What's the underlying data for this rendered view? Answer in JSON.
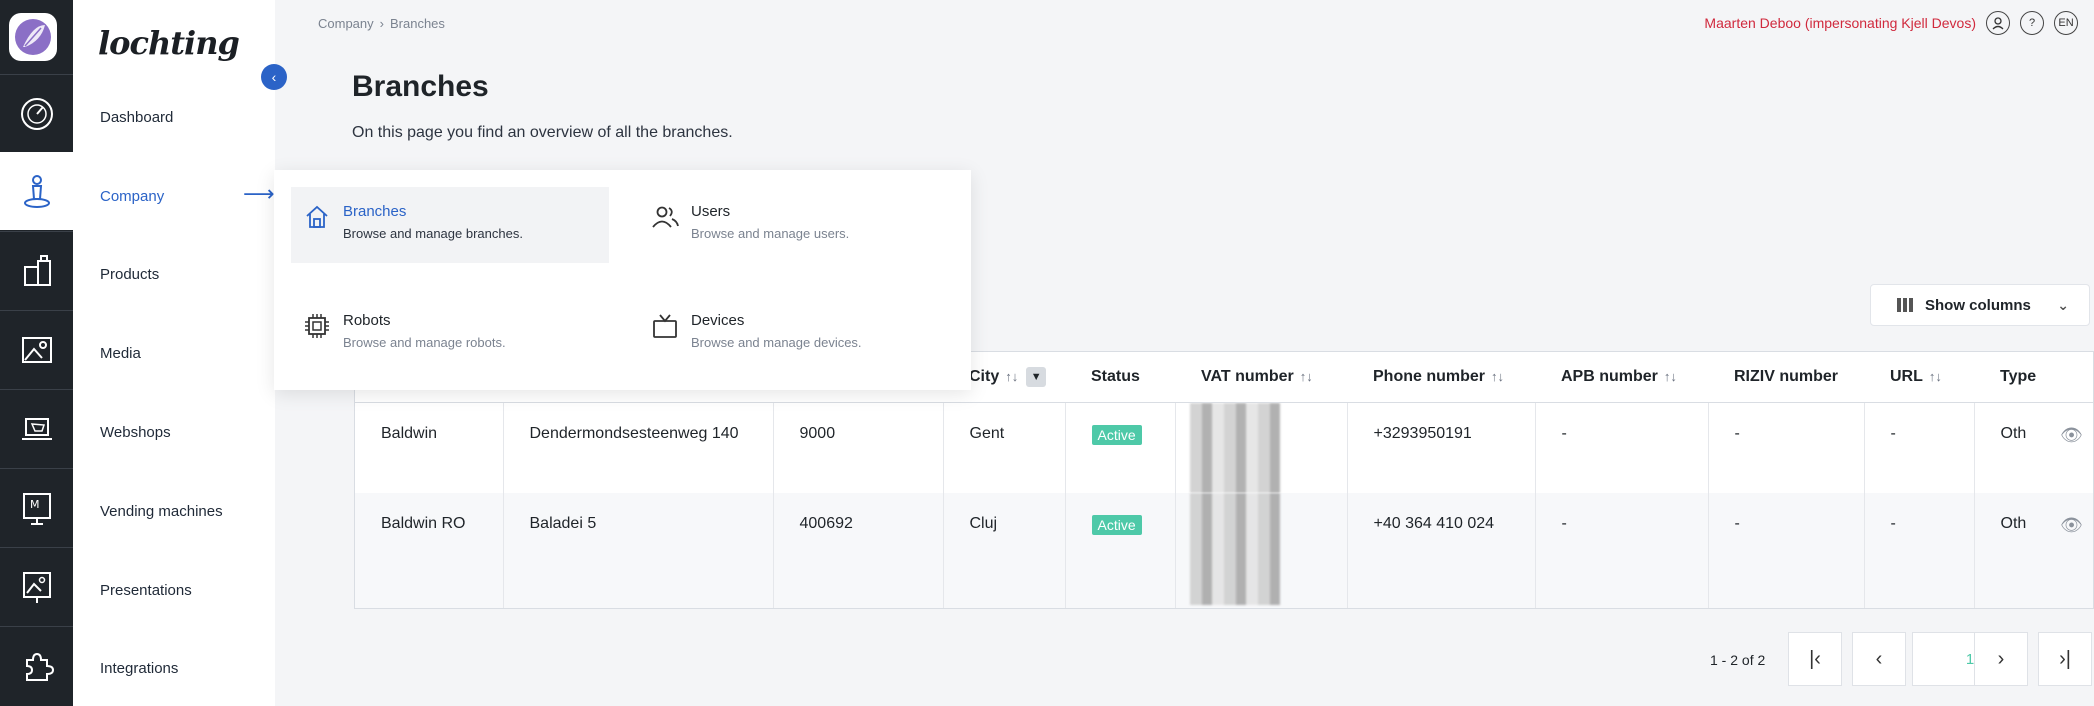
{
  "app": {
    "brand": "lochting"
  },
  "menu": {
    "items": [
      {
        "label": "Dashboard",
        "icon": "dashboard-gauge-icon"
      },
      {
        "label": "Company",
        "icon": "company-person-icon",
        "active": true
      },
      {
        "label": "Products",
        "icon": "products-icon"
      },
      {
        "label": "Media",
        "icon": "media-image-icon"
      },
      {
        "label": "Webshops",
        "icon": "webshop-laptop-icon"
      },
      {
        "label": "Vending machines",
        "icon": "vending-machine-icon"
      },
      {
        "label": "Presentations",
        "icon": "presentation-icon"
      },
      {
        "label": "Integrations",
        "icon": "puzzle-icon"
      }
    ]
  },
  "breadcrumb": {
    "parent": "Company",
    "current": "Branches"
  },
  "user": {
    "name": "Maarten Deboo (impersonating Kjell Devos)",
    "language": "EN",
    "help": "?"
  },
  "page": {
    "title": "Branches",
    "description": "On this page you find an overview of all the branches."
  },
  "dropdown": {
    "items": [
      {
        "title": "Branches",
        "subtitle": "Browse and manage branches.",
        "icon": "home-icon"
      },
      {
        "title": "Users",
        "subtitle": "Browse and manage users.",
        "icon": "users-icon"
      },
      {
        "title": "Robots",
        "subtitle": "Browse and manage robots.",
        "icon": "chip-icon"
      },
      {
        "title": "Devices",
        "subtitle": "Browse and manage devices.",
        "icon": "tv-icon"
      }
    ]
  },
  "toolbar": {
    "show_columns": "Show columns"
  },
  "table": {
    "headers": {
      "city": "City",
      "status": "Status",
      "vat": "VAT number",
      "phone": "Phone number",
      "apb": "APB number",
      "riziv": "RIZIV number",
      "url": "URL",
      "type": "Type"
    },
    "rows": [
      {
        "name": "Baldwin",
        "address": "Dendermondsesteenweg 140",
        "postal": "9000",
        "city": "Gent",
        "status": "Active",
        "phone": "+3293950191",
        "apb": "-",
        "riziv": "-",
        "url": "-",
        "type": "Oth"
      },
      {
        "name": "Baldwin RO",
        "address": "Baladei 5",
        "postal": "400692",
        "city": "Cluj",
        "status": "Active",
        "phone": "+40 364 410 024",
        "apb": "-",
        "riziv": "-",
        "url": "-",
        "type": "Oth"
      }
    ]
  },
  "pagination": {
    "summary": "1 - 2 of 2",
    "current_page": "1"
  },
  "colors": {
    "accent": "#2b63c7",
    "active_badge": "#4ec9a8",
    "user_name": "#d0293d",
    "rail": "#1f2429"
  }
}
